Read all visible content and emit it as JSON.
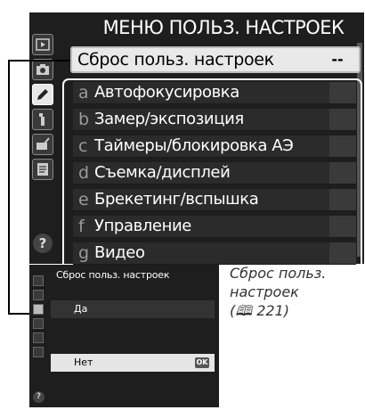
{
  "main_screen": {
    "title": "МЕНЮ ПОЛЬЗ. НАСТРОЕК",
    "reset_row": {
      "label": "Сброс польз. настроек",
      "value": "--"
    },
    "banks": [
      {
        "letter": "a",
        "text": "Автофокусировка"
      },
      {
        "letter": "b",
        "text": "Замер/экспозиция"
      },
      {
        "letter": "c",
        "text": "Таймеры/блокировка АЭ"
      },
      {
        "letter": "d",
        "text": "Съемка/дисплей"
      },
      {
        "letter": "e",
        "text": "Брекетинг/вспышка"
      },
      {
        "letter": "f",
        "text": "Управление"
      },
      {
        "letter": "g",
        "text": "Видео"
      }
    ],
    "tabs": [
      "playback-icon",
      "camera-icon",
      "pencil-icon",
      "wrench-icon",
      "retouch-icon",
      "my-menu-icon"
    ],
    "help": "?"
  },
  "sub_screen": {
    "title": "Сброс польз. настроек",
    "options": [
      {
        "label": "Да",
        "selected": false
      },
      {
        "label": "Нет",
        "selected": true,
        "badge": "OK"
      }
    ],
    "help": "?"
  },
  "caption": {
    "text": "Сброс польз. настроек",
    "ref": "(\u0000 221)",
    "ref_symbol": "🕮",
    "page": "221"
  }
}
